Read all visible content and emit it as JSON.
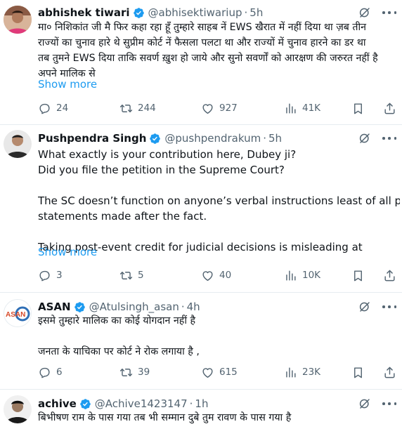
{
  "tweets": [
    {
      "name": "abhishek tiwari",
      "handle": "@abhisektiwariup",
      "time": "5h",
      "lines": [
        "मा० निशिकांत जी मै फिर कहा रहा हूँ तुम्हारे साहब नें EWS खैरात में नहीं दिया था ज़ब तीन",
        "राज्यों का चुनाव हारे थे सुप्रीम कोर्ट नें फैसला पलटा था और राज्यों में चुनाव हारने का डर था",
        "तब तुमने EWS दिया ताकि सवर्ण ख़ुश हो जाये और सुनो सवर्णों को आरक्षण की जरुरत नहीं है",
        "अपने मालिक से"
      ],
      "show_more": "Show more",
      "replies": "24",
      "reposts": "244",
      "likes": "927",
      "views": "41K"
    },
    {
      "name": "Pushpendra Singh",
      "handle": "@pushpendrakum",
      "time": "5h",
      "lines": [
        "What exactly is your contribution here, Dubey ji?",
        "Did you file the petition in the Supreme Court?",
        "",
        "The SC doesn’t function on anyone’s verbal instructions least of all political",
        "statements made after the fact.",
        "",
        "Taking post-event credit for judicial decisions is misleading at"
      ],
      "show_more": "Show more",
      "replies": "3",
      "reposts": "5",
      "likes": "40",
      "views": "10K"
    },
    {
      "name": "ASAN",
      "handle": "@Atulsingh_asan",
      "time": "4h",
      "avatar_text": "ASAN",
      "lines": [
        "इसमे तुम्हारे मालिक का कोई योगदान नहीं है",
        "",
        "जनता के याचिका पर कोर्ट ने रोक लगाया है ,"
      ],
      "replies": "6",
      "reposts": "39",
      "likes": "615",
      "views": "23K"
    },
    {
      "name": "achive",
      "handle": "@Achive1423147",
      "time": "1h",
      "lines": [
        "बिभीषण राम के पास गया तब भी सम्मान दुबे तुम रावण के पास गया है"
      ]
    }
  ],
  "colors": {
    "text": "#0f1419",
    "secondary": "#536471",
    "link": "#1d9bf0",
    "verified": "#1d9bf0",
    "divider": "#e6ecf0"
  },
  "icons": [
    "verified-badge-icon",
    "grok-icon",
    "more-icon",
    "reply-icon",
    "repost-icon",
    "like-icon",
    "views-icon",
    "bookmark-icon",
    "share-icon"
  ]
}
